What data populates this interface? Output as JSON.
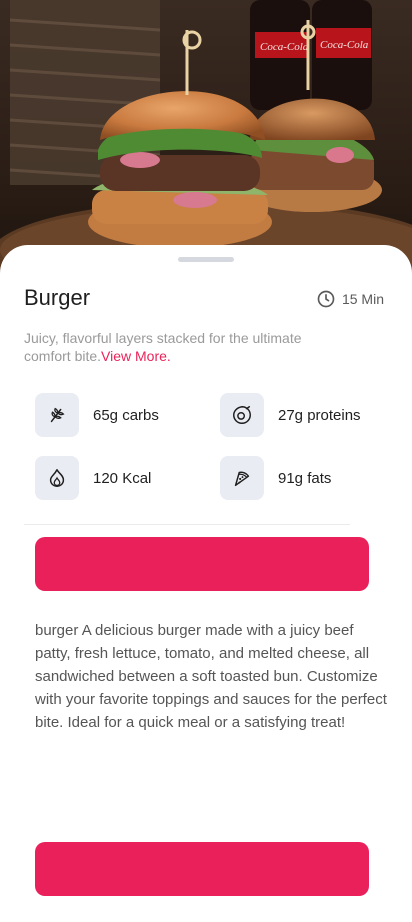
{
  "recipe": {
    "title": "Burger",
    "time": "15 Min",
    "description": "Juicy, flavorful layers stacked for the ultimate comfort bite.",
    "view_more_label": "View More.",
    "long_description": "burger A delicious burger made with a juicy beef patty, fresh lettuce, tomato, and melted cheese, all sandwiched between a soft toasted bun. Customize with your favorite toppings and sauces for the perfect bite. Ideal for a quick meal or a satisfying treat!"
  },
  "nutrients": {
    "carbs": {
      "label": "65g carbs",
      "icon": "wheat-icon"
    },
    "proteins": {
      "label": "27g proteins",
      "icon": "avocado-icon"
    },
    "kcal": {
      "label": "120 Kcal",
      "icon": "flame-icon"
    },
    "fats": {
      "label": "91g fats",
      "icon": "pizza-slice-icon"
    }
  },
  "buttons": {
    "primary_label": "",
    "secondary_label": ""
  },
  "colors": {
    "accent": "#e9205a",
    "tile_bg": "#e9ecf2"
  }
}
